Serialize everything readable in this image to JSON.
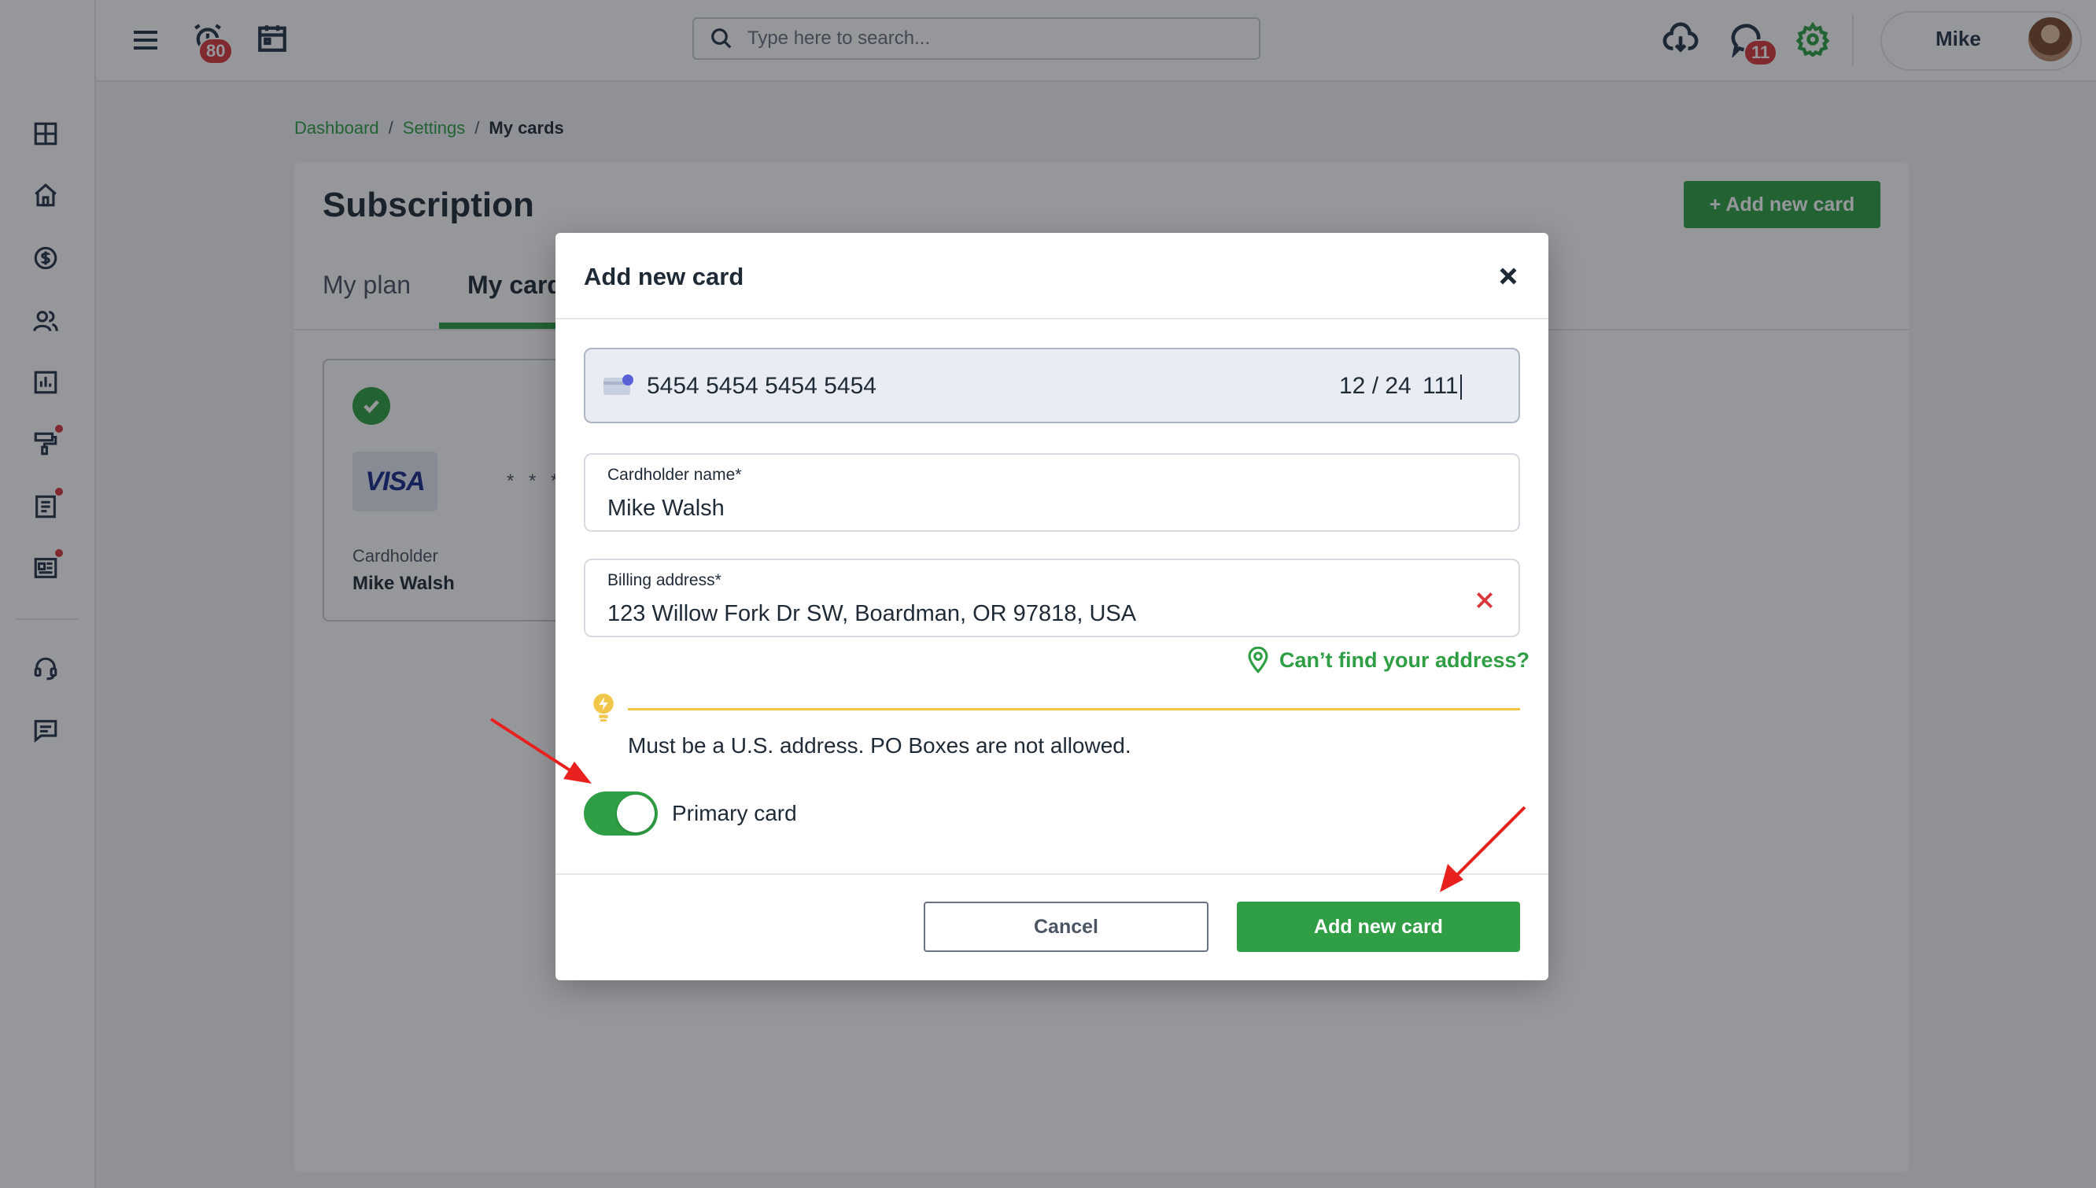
{
  "topbar": {
    "alarm_badge": "80",
    "chat_badge": "11",
    "search_placeholder": "Type here to search...",
    "user_name": "Mike"
  },
  "breadcrumb": {
    "items": [
      "Dashboard",
      "Settings"
    ],
    "separator": "/",
    "current": "My cards"
  },
  "page": {
    "title": "Subscription",
    "add_button": "+ Add new card",
    "tabs": [
      "My plan",
      "My card"
    ],
    "active_tab": "My card",
    "card": {
      "brand": "VISA",
      "masked_number": "* * * *",
      "holder_label": "Cardholder",
      "holder_name": "Mike Walsh"
    }
  },
  "modal": {
    "title": "Add new card",
    "card_number": "5454 5454 5454 5454",
    "expiry": "12 / 24",
    "cvc": "111",
    "cardholder_label": "Cardholder name*",
    "cardholder_value": "Mike Walsh",
    "billing_label": "Billing address*",
    "billing_value": "123 Willow Fork Dr SW, Boardman, OR 97818, USA",
    "cant_find": "Can’t find your address?",
    "tip": "Must be a U.S. address. PO Boxes are not allowed.",
    "primary_label": "Primary card",
    "primary_on": true,
    "cancel_label": "Cancel",
    "submit_label": "Add new card"
  },
  "colors": {
    "accent": "#2f9e44",
    "badge": "#d9373b",
    "tip": "#f2c54b",
    "annotation_arrow": "#e8211f"
  }
}
